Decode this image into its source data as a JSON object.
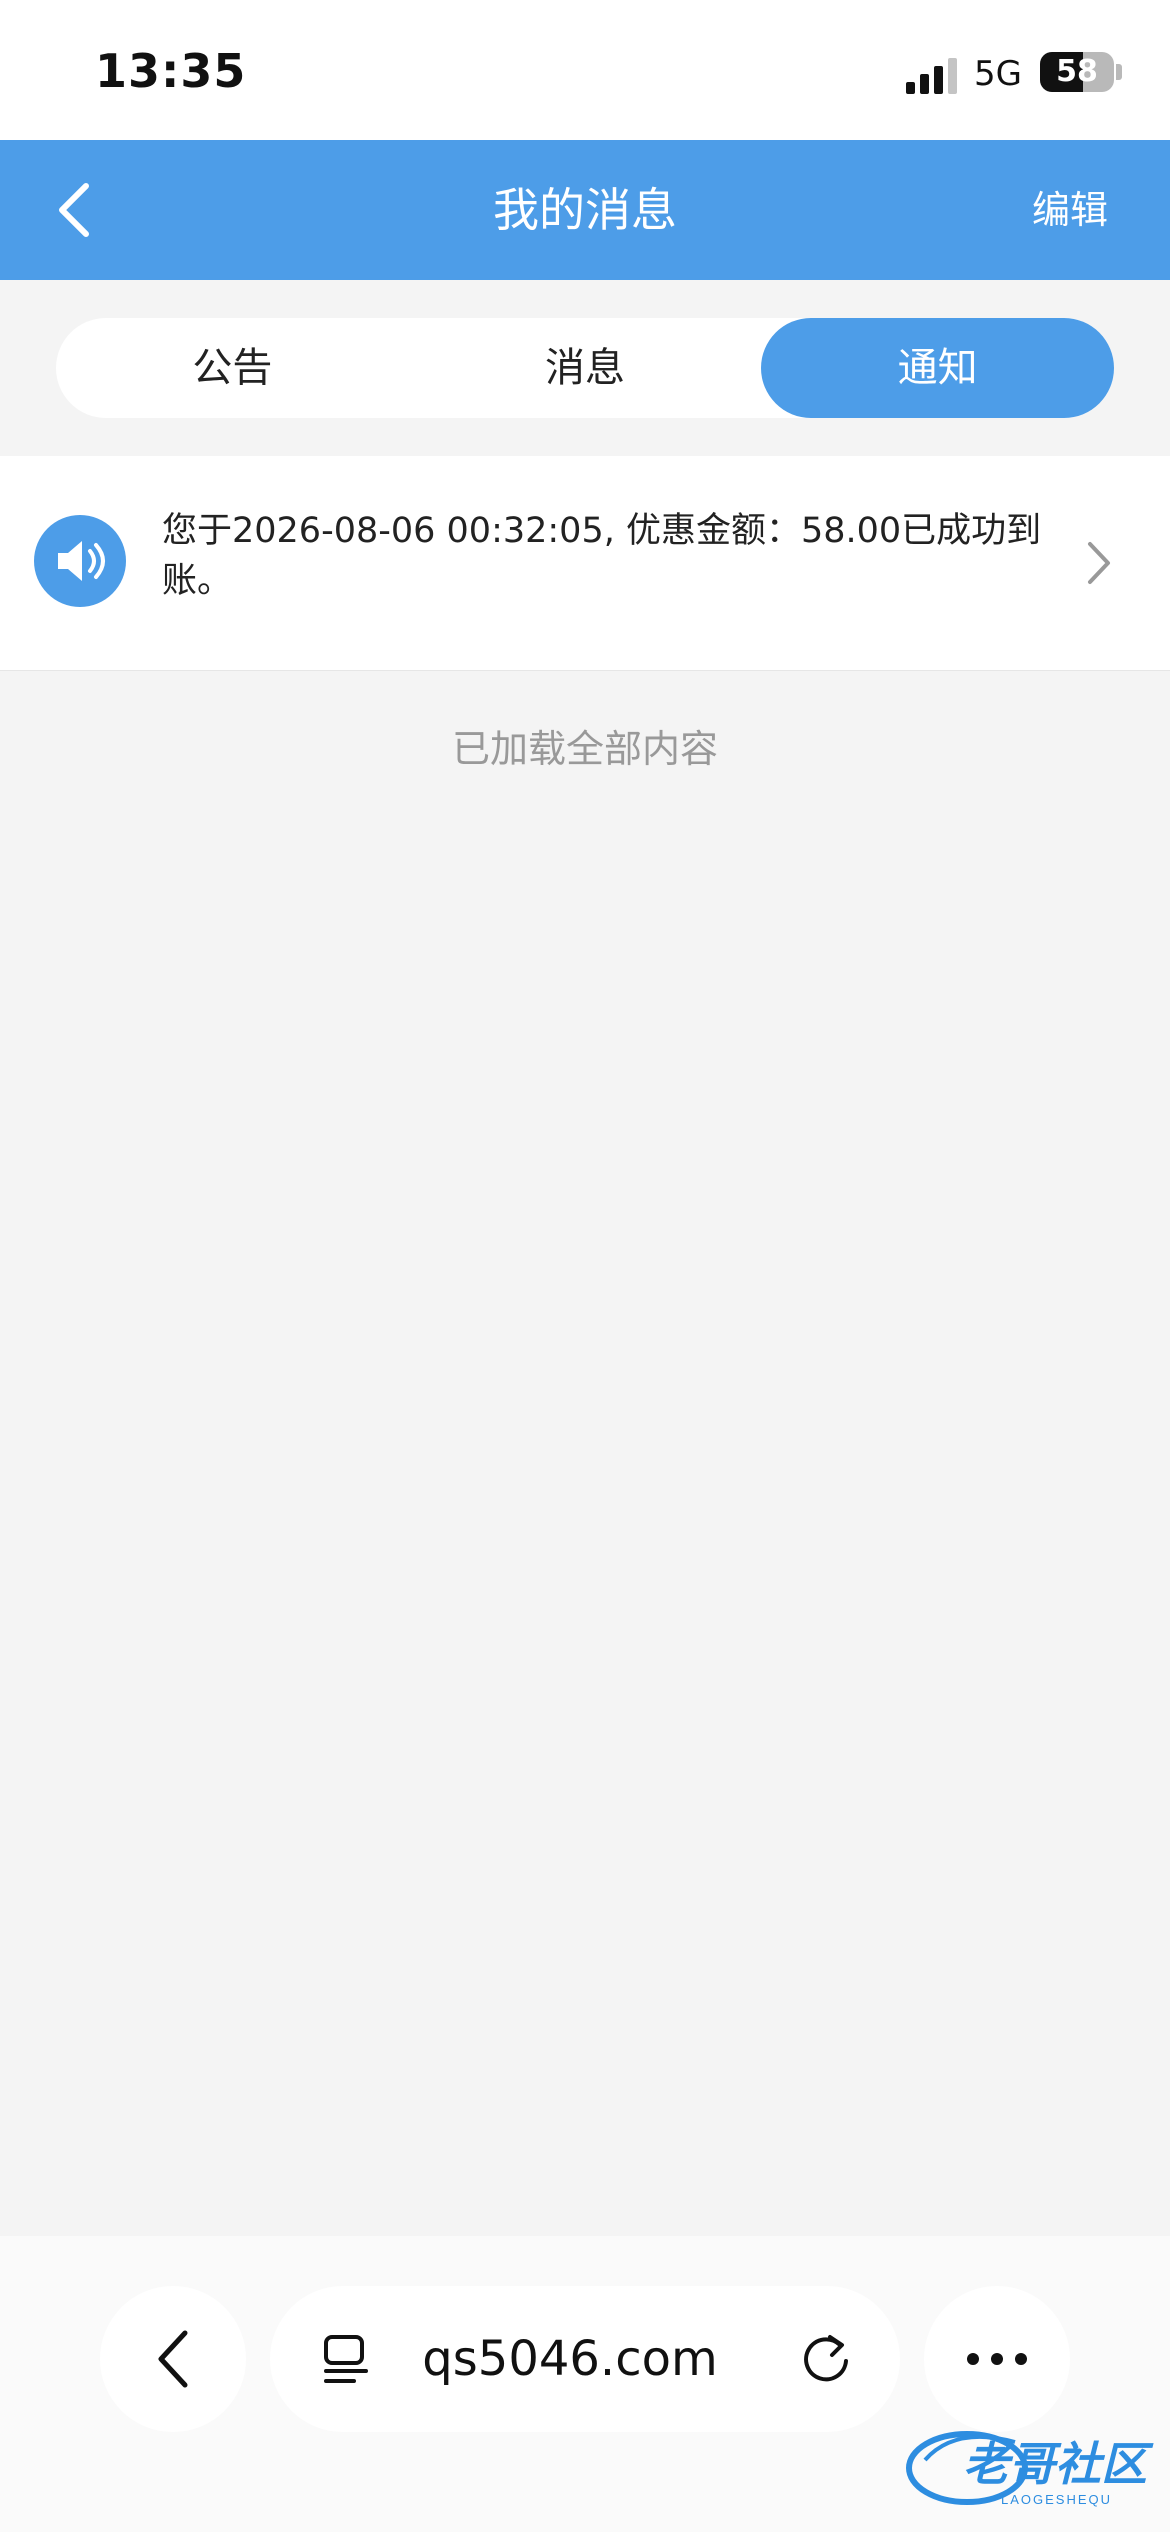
{
  "status_bar": {
    "time": "13:35",
    "network": "5G",
    "battery": "58",
    "battery_level": 0.58
  },
  "navbar": {
    "title": "我的消息",
    "edit_label": "编辑",
    "back_icon": "chevron-left-icon"
  },
  "tabs": [
    {
      "label": "公告",
      "active": false
    },
    {
      "label": "消息",
      "active": false
    },
    {
      "label": "通知",
      "active": true
    }
  ],
  "messages": [
    {
      "icon": "speaker-icon",
      "text": "您于2026-08-06 00:32:05, 优惠金额：58.00已成功到账。"
    }
  ],
  "list_footer": "已加载全部内容",
  "browser": {
    "url": "qs5046.com",
    "back_icon": "chevron-left-icon",
    "reader_icon": "reader-icon",
    "reload_icon": "reload-icon",
    "more_icon": "more-icon"
  },
  "watermark": {
    "text": "老哥社区",
    "subtext": "LAOGESHEQU"
  },
  "colors": {
    "accent": "#4d9de8",
    "background": "#f4f4f4"
  }
}
